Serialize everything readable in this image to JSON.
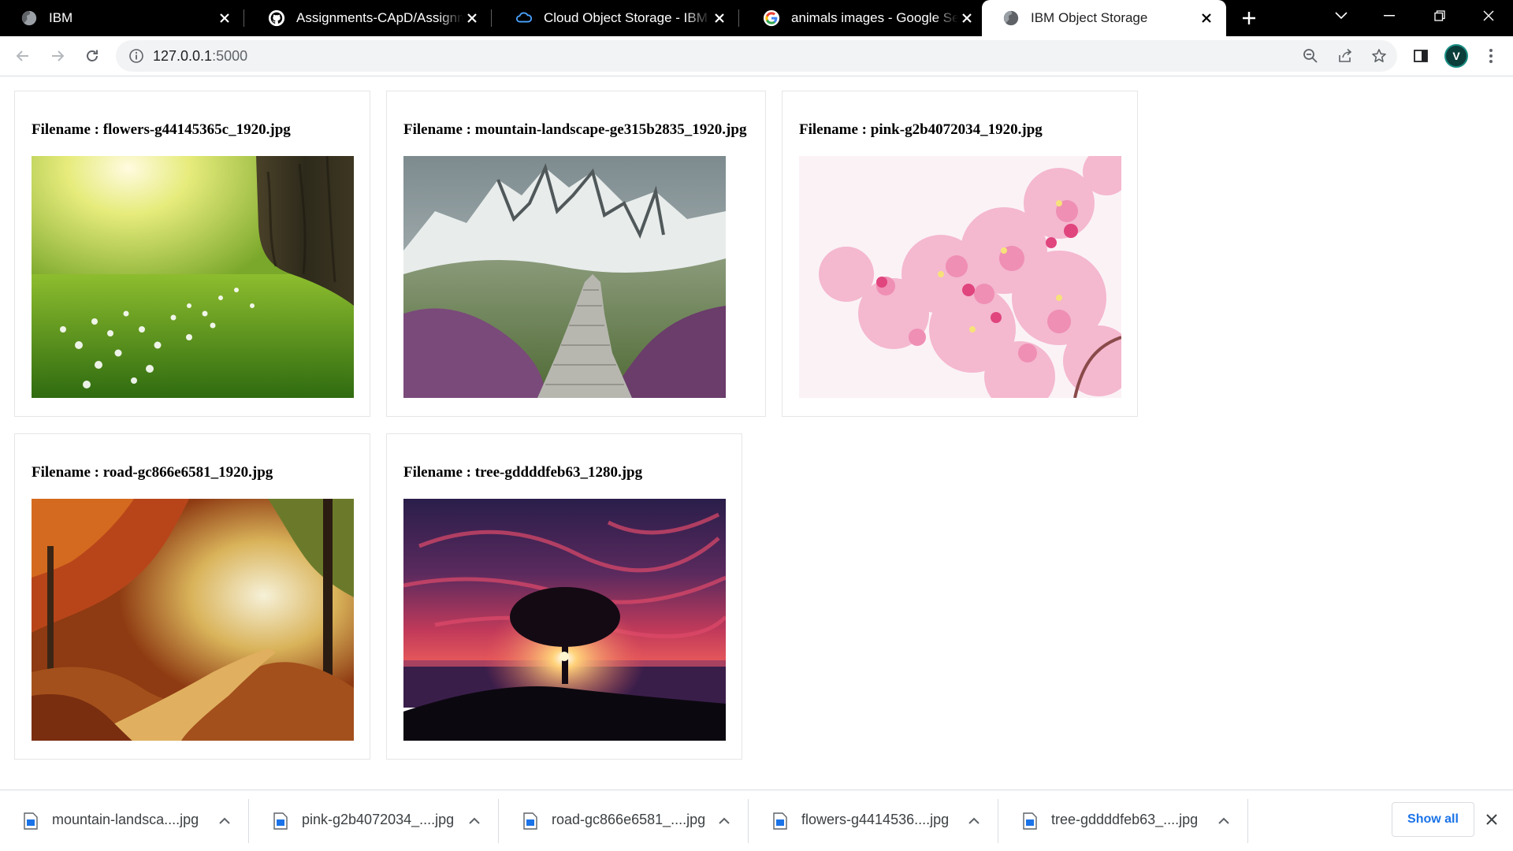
{
  "browser": {
    "tabs": [
      {
        "title": "IBM",
        "favicon": "globe-icon"
      },
      {
        "title": "Assignments-CApD/Assignments",
        "favicon": "github-icon"
      },
      {
        "title": "Cloud Object Storage - IBM Cloud",
        "favicon": "ibm-cloud-icon"
      },
      {
        "title": "animals images - Google Search",
        "favicon": "google-icon"
      },
      {
        "title": "IBM Object Storage",
        "favicon": "globe-icon",
        "active": true
      }
    ],
    "url_host": "127.0.0.1",
    "url_port": ":5000"
  },
  "gallery": {
    "label_prefix": "Filename : ",
    "items": [
      {
        "filename": "flowers-g44145365c_1920.jpg",
        "image": "sunlit meadow with white flowers and tree trunk"
      },
      {
        "filename": "mountain-landscape-ge315b2835_1920.jpg",
        "image": "snowy mountains with stone path and heather"
      },
      {
        "filename": "pink-g2b4072034_1920.jpg",
        "image": "pink cherry blossoms"
      },
      {
        "filename": "road-gc866e6581_1920.jpg",
        "image": "autumn forest road"
      },
      {
        "filename": "tree-gddddfeb63_1280.jpg",
        "image": "tree silhouette at sunset over sea"
      }
    ]
  },
  "downloads": {
    "items": [
      {
        "name": "mountain-landsca....jpg"
      },
      {
        "name": "pink-g2b4072034_....jpg"
      },
      {
        "name": "road-gc866e6581_....jpg"
      },
      {
        "name": "flowers-g4414536....jpg"
      },
      {
        "name": "tree-gddddfeb63_....jpg"
      }
    ],
    "show_all_label": "Show all"
  },
  "colors": {
    "tabstrip": "#000000",
    "link_blue": "#1a73e8",
    "omnibox_bg": "#f1f3f4"
  }
}
